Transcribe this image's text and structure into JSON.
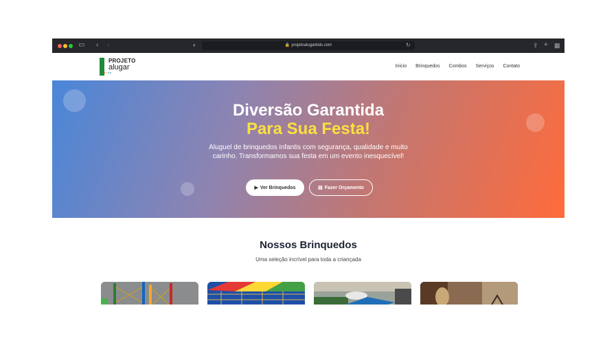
{
  "browser": {
    "url": "projetoalugarkids.com"
  },
  "logo": {
    "line1": "PROJETO",
    "line2": "alugar",
    "line3": [
      "k",
      "i",
      "d",
      "s"
    ]
  },
  "nav": {
    "items": [
      "Início",
      "Brinquedos",
      "Combos",
      "Serviços",
      "Contato"
    ]
  },
  "hero": {
    "title": "Diversão Garantida",
    "subtitle": "Para Sua Festa!",
    "description": "Aluguel de brinquedos infantis com segurança, qualidade e muito carinho. Transformamos sua festa em um evento inesquecível!",
    "primary_button": "Ver Brinquedos",
    "secondary_button": "Fazer Orçamento"
  },
  "section": {
    "title": "Nossos Brinquedos",
    "subtitle": "Uma seleção incrível para toda a criançada"
  },
  "colors": {
    "browser_bar": "#26272b",
    "gradient_start": "#4a86d8",
    "gradient_end": "#ff6b3b",
    "highlight": "#fbe040",
    "logo_green": "#1f8a3b"
  }
}
